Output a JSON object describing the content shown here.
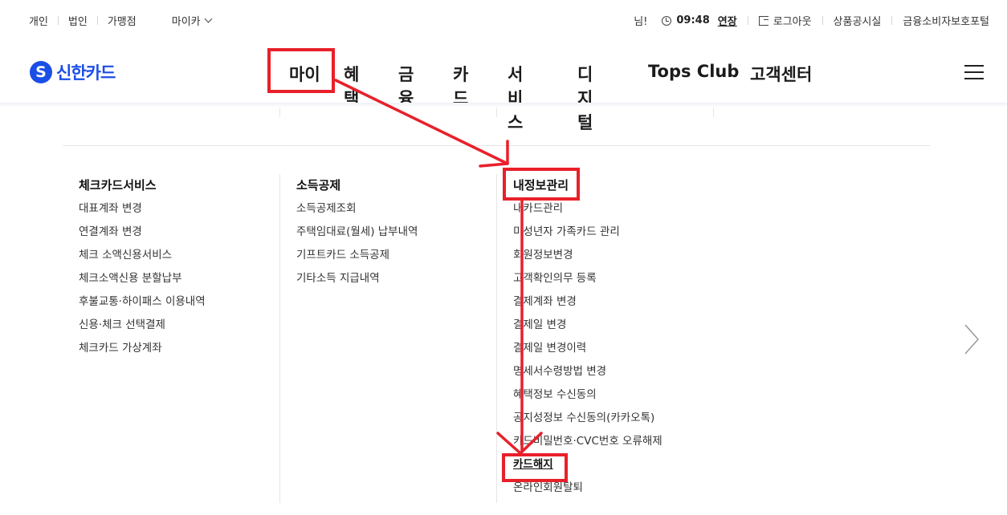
{
  "util": {
    "left": [
      "개인",
      "법인",
      "가맹점"
    ],
    "my_card": "마이카",
    "greeting": "님!",
    "time": "09:48",
    "extend": "연장",
    "logout": "로그아웃",
    "product_notice": "상품공시실",
    "consumer_portal": "금융소비자보호포털"
  },
  "logo": {
    "mark": "S",
    "text": "신한카드"
  },
  "menu": [
    "마이",
    "혜택",
    "금융",
    "카드",
    "서비스",
    "디지털",
    "Tops Club",
    "고객센터"
  ],
  "columns": [
    {
      "title": "체크카드서비스",
      "items": [
        "대표계좌 변경",
        "연결계좌 변경",
        "체크 소액신용서비스",
        "체크소액신용 분할납부",
        "후불교통·하이패스 이용내역",
        "신용·체크 선택결제",
        "체크카드 가상계좌"
      ]
    },
    {
      "title": "소득공제",
      "items": [
        "소득공제조회",
        "주택임대료(월세) 납부내역",
        "기프트카드 소득공제",
        "기타소득 지급내역"
      ]
    },
    {
      "title": "내정보관리",
      "items": [
        "내카드관리",
        "미성년자 가족카드 관리",
        "회원정보변경",
        "고객확인의무 등록",
        "결제계좌 변경",
        "결제일 변경",
        "결제일 변경이력",
        "명세서수령방법 변경",
        "혜택정보 수신동의",
        "공지성정보 수신동의(카카오톡)",
        "카드비밀번호·CVC번호 오류해제",
        "카드해지",
        "온라인회원탈퇴"
      ]
    }
  ],
  "colors": {
    "brand": "#1a4ee6",
    "annotation": "#e8202a"
  },
  "icons": {
    "clock": "clock-icon",
    "logout": "logout-icon",
    "menu": "hamburger-icon",
    "next": "chevron-right-icon"
  }
}
